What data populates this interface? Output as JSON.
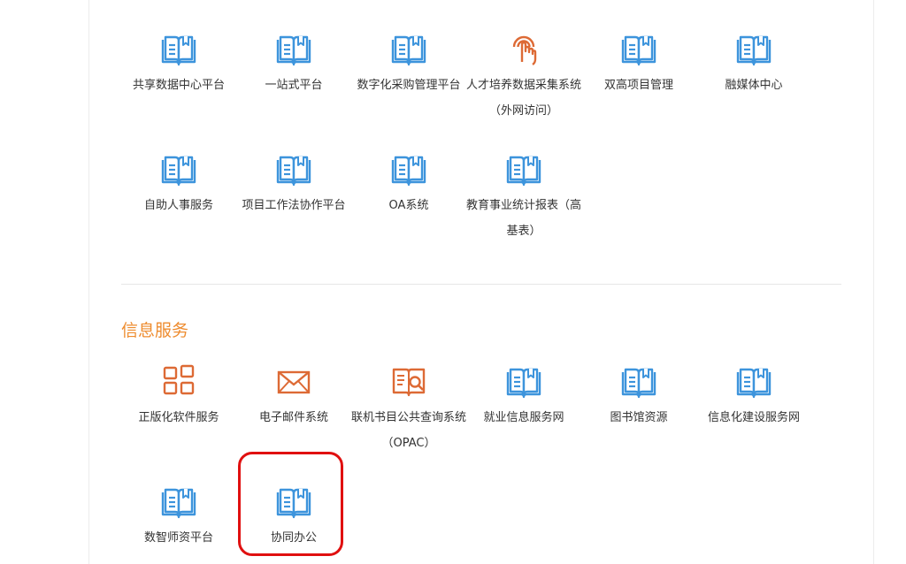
{
  "colors": {
    "accent": "#ee8c2f",
    "icon_blue": "#3d94dc",
    "icon_orange": "#dd6a35",
    "highlight": "#e01010"
  },
  "apps_top": [
    {
      "label": "共享数据中心平台",
      "icon": "book-icon"
    },
    {
      "label": "一站式平台",
      "icon": "book-icon"
    },
    {
      "label": "数字化采购管理平台",
      "icon": "book-icon"
    },
    {
      "label": "人才培养数据采集系统（外网访问）",
      "icon": "touch-icon"
    },
    {
      "label": "双高项目管理",
      "icon": "book-icon"
    },
    {
      "label": "融媒体中心",
      "icon": "book-icon"
    },
    {
      "label": "自助人事服务",
      "icon": "book-icon"
    },
    {
      "label": "项目工作法协作平台",
      "icon": "book-icon"
    },
    {
      "label": "OA系统",
      "icon": "book-icon"
    },
    {
      "label": "教育事业统计报表（高基表）",
      "icon": "book-icon"
    }
  ],
  "info_section": {
    "title": "信息服务",
    "items": [
      {
        "label": "正版化软件服务",
        "icon": "grid-icon"
      },
      {
        "label": "电子邮件系统",
        "icon": "mail-icon"
      },
      {
        "label": "联机书目公共查询系统（OPAC）",
        "icon": "book-search-icon"
      },
      {
        "label": "就业信息服务网",
        "icon": "book-icon"
      },
      {
        "label": "图书馆资源",
        "icon": "book-icon"
      },
      {
        "label": "信息化建设服务网",
        "icon": "book-icon"
      },
      {
        "label": "数智师资平台",
        "icon": "book-icon"
      },
      {
        "label": "协同办公",
        "icon": "book-icon"
      }
    ]
  }
}
